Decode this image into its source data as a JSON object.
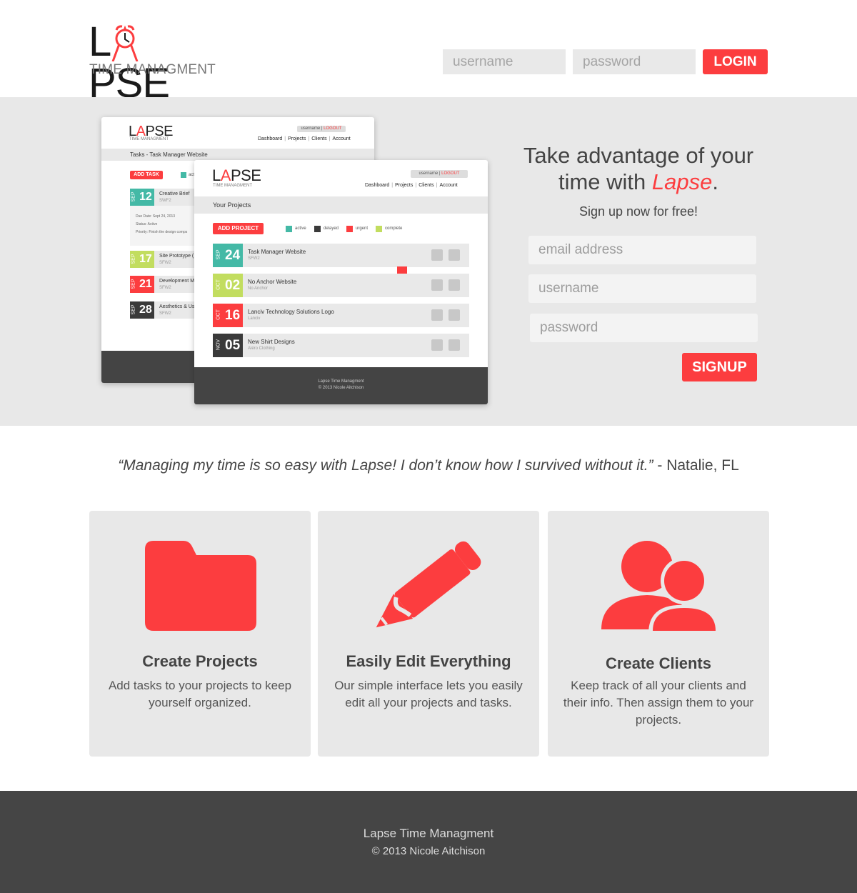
{
  "header": {
    "logo_text_left": "L",
    "logo_text_right": "PSE",
    "logo_subtitle": "TIME MANAGMENT",
    "username_placeholder": "username",
    "password_placeholder": "password",
    "login_label": "LOGIN"
  },
  "colors": {
    "accent": "#fc3d3f",
    "active": "#44b9a6",
    "delayed": "#3a3a3a",
    "urgent": "#fc3d3f",
    "complete": "#c2dd5f",
    "hero_bg": "#e8e8e8",
    "footer_bg": "#454545"
  },
  "preview_back": {
    "logo_left": "L",
    "logo_right": "PSE",
    "logo_sub": "TIME MANAGMENT",
    "user": "username",
    "logout": "LOGOUT",
    "nav": [
      "Dashboard",
      "Projects",
      "Clients",
      "Account"
    ],
    "bar_title": "Tasks - Task Manager Website",
    "add_label": "ADD TASK",
    "legend_first": "active",
    "tasks": [
      {
        "month": "SEP",
        "day": "12",
        "title": "Creative Brief",
        "sub": "SWF2"
      },
      {
        "month": "SEP",
        "day": "17",
        "title": "Site Prototype (",
        "sub": "SFW2"
      },
      {
        "month": "SEP",
        "day": "21",
        "title": "Development M",
        "sub": "SFW2"
      },
      {
        "month": "SEP",
        "day": "28",
        "title": "Aesthetics & Us",
        "sub": "SFW2"
      }
    ],
    "detail": {
      "due": "Due Date:  Sept 24, 2013",
      "status": "Status:  Active",
      "priority": "Priority:  Finish the design comps"
    }
  },
  "preview_front": {
    "logo_left": "L",
    "logo_right": "PSE",
    "logo_sub": "TIME MANAGMENT",
    "user": "username",
    "logout": "LOGOUT",
    "nav": [
      "Dashboard",
      "Projects",
      "Clients",
      "Account"
    ],
    "bar_title": "Your Projects",
    "add_label": "ADD PROJECT",
    "legend": [
      "active",
      "delayed",
      "urgent",
      "complete"
    ],
    "projects": [
      {
        "month": "SEP",
        "day": "24",
        "title": "Task Manager Website",
        "sub": "SFW2"
      },
      {
        "month": "OCT",
        "day": "02",
        "title": "No Anchor Website",
        "sub": "No Anchor"
      },
      {
        "month": "OCT",
        "day": "16",
        "title": "Lanciv Technology Solutions Logo",
        "sub": "Lanciv"
      },
      {
        "month": "NOV",
        "day": "05",
        "title": "New Shirt Designs",
        "sub": "Aléro Clothing"
      }
    ],
    "footer_line1": "Lapse Time Managment",
    "footer_line2": "© 2013 Nicole Aitchison"
  },
  "hero": {
    "title_line1": "Take advantage of your",
    "title_line2_pre": "time with ",
    "title_brand": "Lapse",
    "title_end": ".",
    "subtitle": "Sign up now for free!",
    "email_placeholder": "email address",
    "username_placeholder": "username",
    "password_placeholder": "password",
    "signup_label": "SIGNUP"
  },
  "testimonial": {
    "quote": "“Managing my time is so easy with Lapse! I don’t know how I survived without it.”",
    "author": " - Natalie, FL"
  },
  "features": [
    {
      "icon": "folder-icon",
      "title": "Create Projects",
      "desc": "Add tasks to your projects to keep yourself organized."
    },
    {
      "icon": "pencil-icon",
      "title": "Easily Edit Everything",
      "desc": "Our simple interface lets you easily edit all your projects and tasks."
    },
    {
      "icon": "users-icon",
      "title": "Create Clients",
      "desc": "Keep track of all your clients and their info. Then assign them to your projects."
    }
  ],
  "footer": {
    "line1": "Lapse Time Managment",
    "line2": "© 2013 Nicole Aitchison"
  }
}
